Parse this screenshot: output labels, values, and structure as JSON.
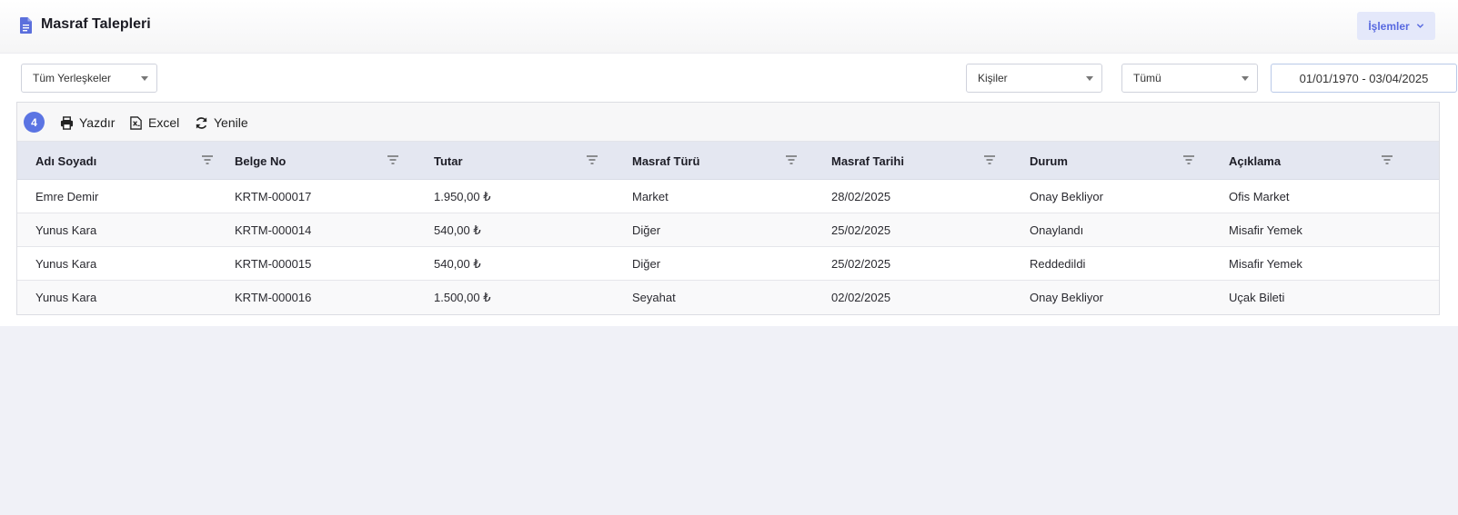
{
  "header": {
    "title": "Masraf Talepleri",
    "title_icon": "document-icon",
    "actions_label": "İşlemler"
  },
  "filters": {
    "campus": "Tüm Yerleşkeler",
    "people": "Kişiler",
    "status": "Tümü",
    "date_range": "01/01/1970 - 03/04/2025"
  },
  "toolbar": {
    "count": "4",
    "print_label": "Yazdır",
    "excel_label": "Excel",
    "refresh_label": "Yenile"
  },
  "table": {
    "columns": [
      "Adı Soyadı",
      "Belge No",
      "Tutar",
      "Masraf Türü",
      "Masraf Tarihi",
      "Durum",
      "Açıklama"
    ],
    "rows": [
      [
        "Emre Demir",
        "KRTM-000017",
        "1.950,00 ₺",
        "Market",
        "28/02/2025",
        "Onay Bekliyor",
        "Ofis Market"
      ],
      [
        "Yunus Kara",
        "KRTM-000014",
        "540,00 ₺",
        "Diğer",
        "25/02/2025",
        "Onaylandı",
        "Misafir Yemek"
      ],
      [
        "Yunus Kara",
        "KRTM-000015",
        "540,00 ₺",
        "Diğer",
        "25/02/2025",
        "Reddedildi",
        "Misafir Yemek"
      ],
      [
        "Yunus Kara",
        "KRTM-000016",
        "1.500,00 ₺",
        "Seyahat",
        "02/02/2025",
        "Onay Bekliyor",
        "Uçak Bileti"
      ]
    ]
  },
  "colors": {
    "accent": "#5b74e3",
    "header_row_bg": "#e4e7f1",
    "actions_button_bg": "#e4e8fa"
  }
}
